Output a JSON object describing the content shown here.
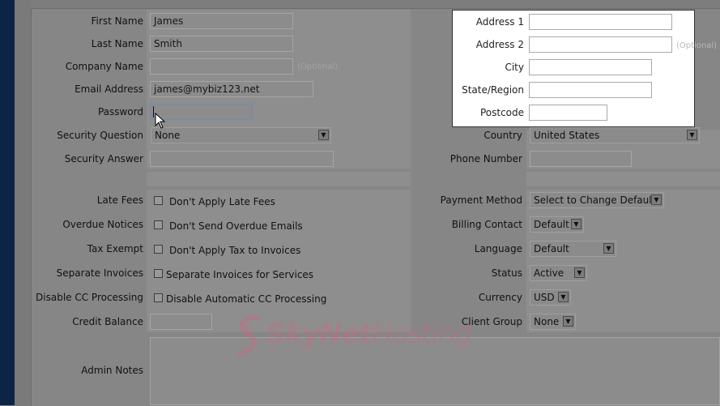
{
  "form": {
    "left": {
      "first_name": {
        "label": "First Name",
        "value": "James"
      },
      "last_name": {
        "label": "Last Name",
        "value": "Smith"
      },
      "company_name": {
        "label": "Company Name",
        "value": "",
        "optional": "(Optional)"
      },
      "email": {
        "label": "Email Address",
        "value": "james@mybiz123.net"
      },
      "password": {
        "label": "Password",
        "value": ""
      },
      "security_question": {
        "label": "Security Question",
        "value": "None"
      },
      "security_answer": {
        "label": "Security Answer",
        "value": ""
      },
      "late_fees": {
        "label": "Late Fees",
        "option": "Don't Apply Late Fees"
      },
      "overdue_notices": {
        "label": "Overdue Notices",
        "option": "Don't Send Overdue Emails"
      },
      "tax_exempt": {
        "label": "Tax Exempt",
        "option": "Don't Apply Tax to Invoices"
      },
      "separate_invoices": {
        "label": "Separate Invoices",
        "option": "Separate Invoices for Services"
      },
      "disable_cc": {
        "label": "Disable CC Processing",
        "option": "Disable Automatic CC Processing"
      },
      "credit_balance": {
        "label": "Credit Balance",
        "value": ""
      },
      "admin_notes": {
        "label": "Admin Notes"
      }
    },
    "right": {
      "address1": {
        "label": "Address 1",
        "value": ""
      },
      "address2": {
        "label": "Address 2",
        "value": "",
        "optional": "(Optional)"
      },
      "city": {
        "label": "City",
        "value": ""
      },
      "state": {
        "label": "State/Region",
        "value": ""
      },
      "postcode": {
        "label": "Postcode",
        "value": ""
      },
      "country": {
        "label": "Country",
        "value": "United States"
      },
      "phone": {
        "label": "Phone Number",
        "value": ""
      },
      "payment_method": {
        "label": "Payment Method",
        "value": "Select to Change Default"
      },
      "billing_contact": {
        "label": "Billing Contact",
        "value": "Default"
      },
      "language": {
        "label": "Language",
        "value": "Default"
      },
      "status": {
        "label": "Status",
        "value": "Active"
      },
      "currency": {
        "label": "Currency",
        "value": "USD"
      },
      "client_group": {
        "label": "Client Group",
        "value": "None"
      }
    }
  },
  "watermark": {
    "brand_a": "SkyNet",
    "brand_b": "Hosting"
  },
  "colors": {
    "sidebar": "#0d2446",
    "watermark": "#be6e82"
  }
}
